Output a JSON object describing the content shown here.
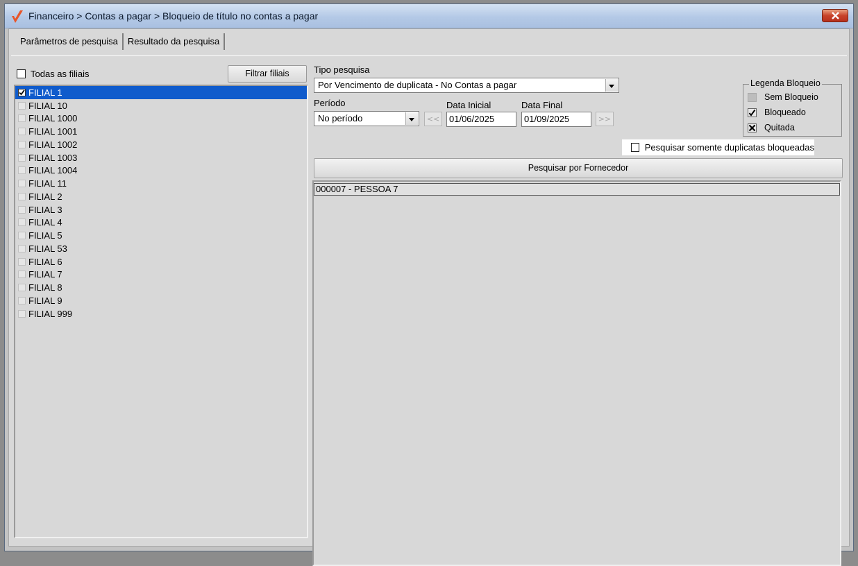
{
  "window": {
    "title": "Financeiro > Contas a pagar > Bloqueio de título no contas a pagar",
    "accent": "#e8552a"
  },
  "tabs": [
    {
      "label": "Parâmetros de pesquisa",
      "active": true
    },
    {
      "label": "Resultado da pesquisa",
      "active": false
    }
  ],
  "branches": {
    "all_label": "Todas as filiais",
    "filter_button": "Filtrar filiais",
    "items": [
      {
        "label": "FILIAL 1",
        "checked": true,
        "selected": true
      },
      {
        "label": "FILIAL 10",
        "checked": false
      },
      {
        "label": "FILIAL 1000",
        "checked": false
      },
      {
        "label": "FILIAL 1001",
        "checked": false
      },
      {
        "label": "FILIAL 1002",
        "checked": false
      },
      {
        "label": "FILIAL 1003",
        "checked": false
      },
      {
        "label": "FILIAL 1004",
        "checked": false
      },
      {
        "label": "FILIAL 11",
        "checked": false
      },
      {
        "label": "FILIAL 2",
        "checked": false
      },
      {
        "label": "FILIAL 3",
        "checked": false
      },
      {
        "label": "FILIAL 4",
        "checked": false
      },
      {
        "label": "FILIAL 5",
        "checked": false
      },
      {
        "label": "FILIAL 53",
        "checked": false
      },
      {
        "label": "FILIAL 6",
        "checked": false
      },
      {
        "label": "FILIAL 7",
        "checked": false
      },
      {
        "label": "FILIAL 8",
        "checked": false
      },
      {
        "label": "FILIAL 9",
        "checked": false
      },
      {
        "label": "FILIAL 999",
        "checked": false
      }
    ],
    "selection_color": "#0f5bcc"
  },
  "search": {
    "type_label": "Tipo pesquisa",
    "type_value": "Por Vencimento de duplicata - No Contas a pagar",
    "period_label": "Período",
    "period_value": "No período",
    "prev_label": "<<",
    "next_label": ">>",
    "start_label": "Data Inicial",
    "start_value": "01/06/2025",
    "end_label": "Data Final",
    "end_value": "01/09/2025",
    "only_blocked_label": "Pesquisar somente duplicatas bloqueadas",
    "only_blocked_checked": false
  },
  "legend": {
    "title": "Legenda Bloqueio",
    "items": [
      {
        "label": "Sem Bloqueio",
        "icon": "unchecked-box-icon"
      },
      {
        "label": "Bloqueado",
        "icon": "checked-box-icon"
      },
      {
        "label": "Quitada",
        "icon": "x-box-icon"
      }
    ]
  },
  "supplier": {
    "button_label": "Pesquisar por Fornecedor",
    "rows": [
      "000007 - PESSOA 7"
    ]
  }
}
